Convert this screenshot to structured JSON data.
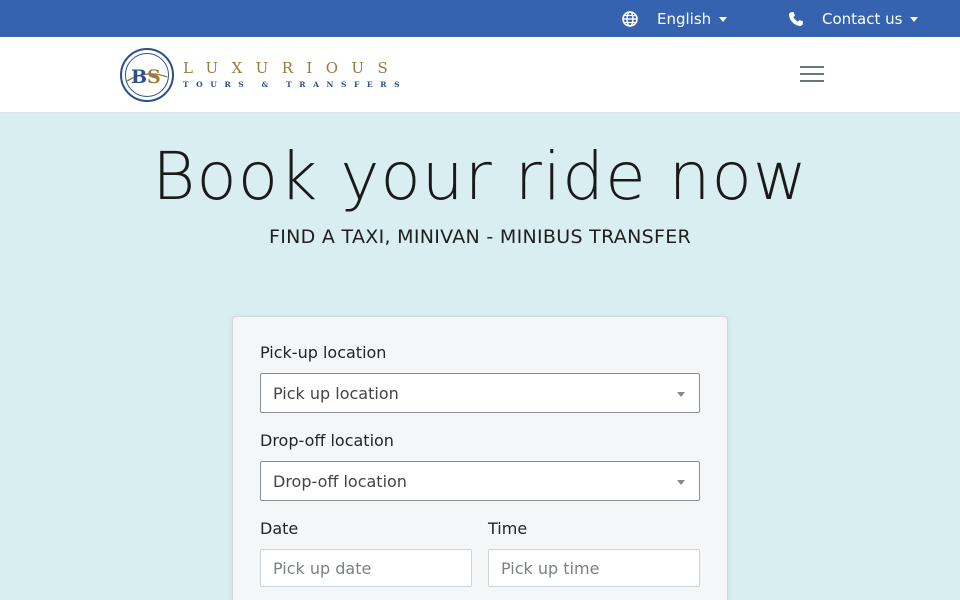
{
  "topbar": {
    "language_icon": "globe-icon",
    "language_label": "English",
    "contact_icon": "phone-icon",
    "contact_label": "Contact us",
    "colors": {
      "background": "#3563b0",
      "text": "#ffffff"
    }
  },
  "navbar": {
    "logo_initials": "B S",
    "logo_word": "LUXURIOUS",
    "logo_sub": "TOURS & TRANSFERS",
    "menu_icon": "hamburger-menu-icon"
  },
  "hero": {
    "title": "Book your ride now",
    "subtitle": "FIND A TAXI, MINIVAN - MINIBUS TRANSFER",
    "background": "#d8eef1"
  },
  "booking_form": {
    "pickup": {
      "label": "Pick-up location",
      "selected": "Pick up location"
    },
    "dropoff": {
      "label": "Drop-off location",
      "selected": "Drop-off location"
    },
    "date": {
      "label": "Date",
      "placeholder": "Pick up date",
      "value": ""
    },
    "time": {
      "label": "Time",
      "placeholder": "Pick up time",
      "value": ""
    }
  }
}
